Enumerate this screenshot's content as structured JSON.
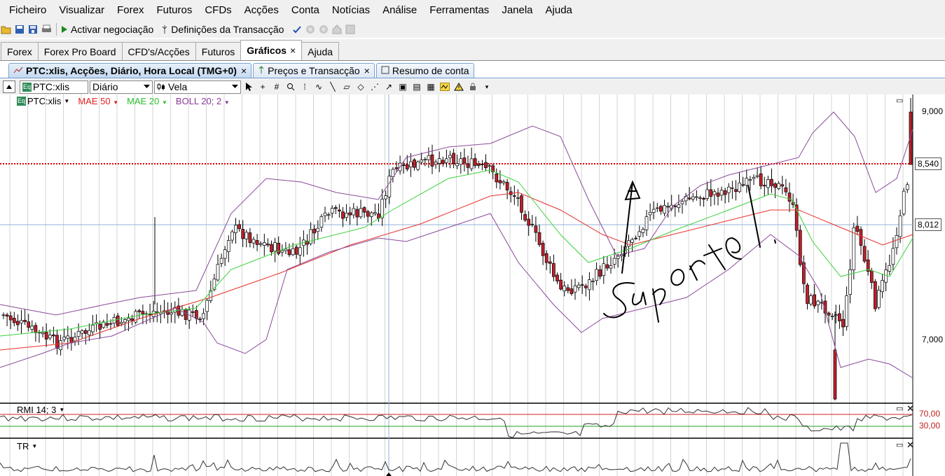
{
  "menu": [
    "Ficheiro",
    "Visualizar",
    "Forex",
    "Futuros",
    "CFDs",
    "Acções",
    "Conta",
    "Notícias",
    "Análise",
    "Ferramentas",
    "Janela",
    "Ajuda"
  ],
  "toolbar": {
    "activate_label": "Activar negociação",
    "settings_label": "Definições da Transacção"
  },
  "tabs": [
    {
      "label": "Forex"
    },
    {
      "label": "Forex Pro Board"
    },
    {
      "label": "CFD's/Acções"
    },
    {
      "label": "Futuros"
    },
    {
      "label": "Gráficos",
      "active": true
    },
    {
      "label": "Ajuda"
    }
  ],
  "tab_close": "×",
  "subtabs": [
    {
      "label": "PTC:xlis, Acções, Diário, Hora Local (TMG+0)",
      "active": true,
      "closable": true
    },
    {
      "label": "Preços e Transacção",
      "closable": true
    },
    {
      "label": "Resumo de conta",
      "closable": false
    }
  ],
  "chart_toolbar": {
    "instrument": "PTC:xlis",
    "period": "Diário",
    "chart_type": "Vela",
    "eq_badge": "Eq"
  },
  "legend": {
    "instrument": "PTC:xlis",
    "mae50": "MAE 50",
    "mae20": "MAE 20",
    "boll": "BOLL 20; 2"
  },
  "price_axis": {
    "labels": [
      "9,000",
      "7,000"
    ],
    "tags": [
      "8,540",
      "8,012"
    ]
  },
  "rmi": {
    "label": "RMI 14; 3",
    "levels": [
      "70,00",
      "30,00"
    ]
  },
  "tr": {
    "label": "TR"
  },
  "annotation": "Suporte!",
  "colors": {
    "mae50": "#e8302a",
    "mae20": "#3ad23a",
    "boll": "#8a4a9a",
    "candle_up": "#ffffff",
    "candle_down": "#c0202a",
    "hline_red": "#e00000",
    "hline_blue": "#8fb4d8"
  },
  "icons": [
    "open-icon",
    "save-icon",
    "save-all-icon",
    "print-icon",
    "play-icon",
    "settings-icon",
    "check-icon",
    "cursor-icon",
    "crosshair-icon",
    "grid-icon",
    "zoom-icon",
    "warning-icon"
  ]
}
